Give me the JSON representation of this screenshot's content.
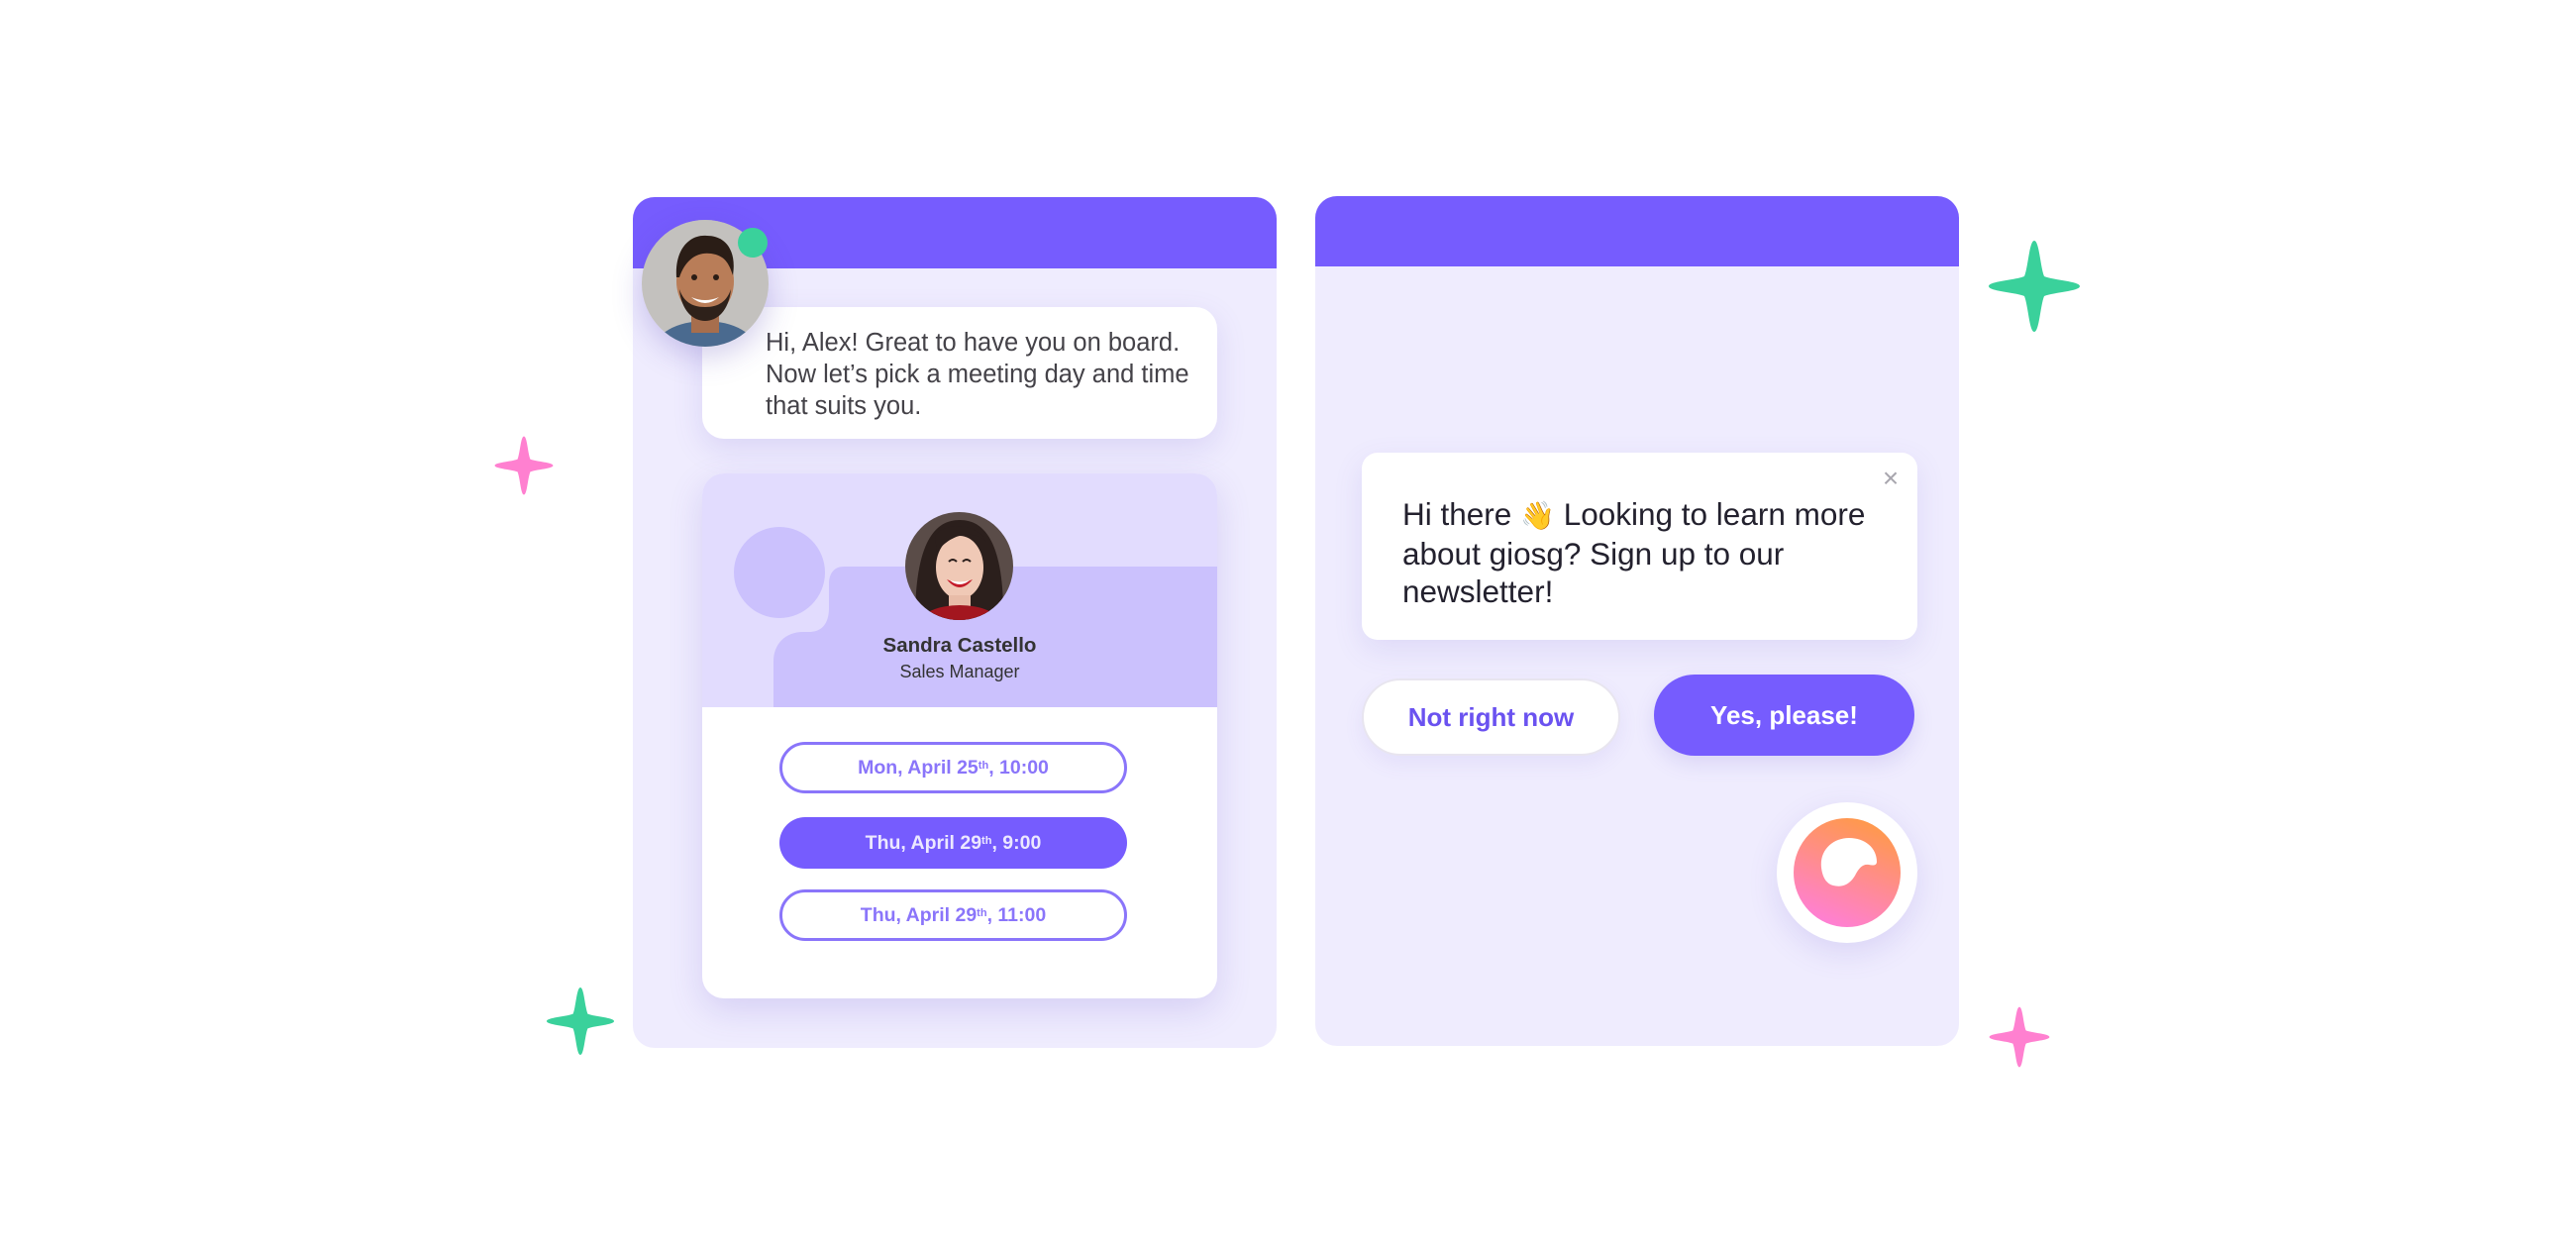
{
  "colors": {
    "brand_purple": "#765cfe",
    "panel_bg": "#efecfe",
    "online_green": "#3ad19b",
    "sparkle_green": "#3ad19b",
    "sparkle_pink": "#ff80d0",
    "slot_outline": "#8a75fa",
    "logo_gradient_top": "#ff9a45",
    "logo_gradient_bottom": "#ff7fd6"
  },
  "left_widget": {
    "agent_status": "online",
    "message": "Hi, Alex! Great to have you on board. Now let’s pick a meeting day and time that suits you.",
    "booking_card": {
      "host_name": "Sandra Castello",
      "host_title": "Sales Manager",
      "slots": [
        {
          "day": "Mon, April 25",
          "suffix": "th",
          "time": ", 10:00",
          "selected": false
        },
        {
          "day": "Thu, April 29",
          "suffix": "th",
          "time": ", 9:00",
          "selected": true
        },
        {
          "day": "Thu, April 29",
          "suffix": "th",
          "time": ", 11:00",
          "selected": false
        }
      ]
    }
  },
  "right_widget": {
    "newsletter": {
      "text_before_emoji": "Hi there ",
      "emoji": "👋",
      "text_after_emoji": " Looking to learn more about giosg? Sign up to our newsletter!",
      "close_symbol": "×"
    },
    "decline_label": "Not right now",
    "accept_label": "Yes, please!",
    "launcher_icon": "giosg-logo-icon"
  },
  "decorations": {
    "sparkles": [
      "pink",
      "green",
      "green",
      "pink"
    ]
  }
}
